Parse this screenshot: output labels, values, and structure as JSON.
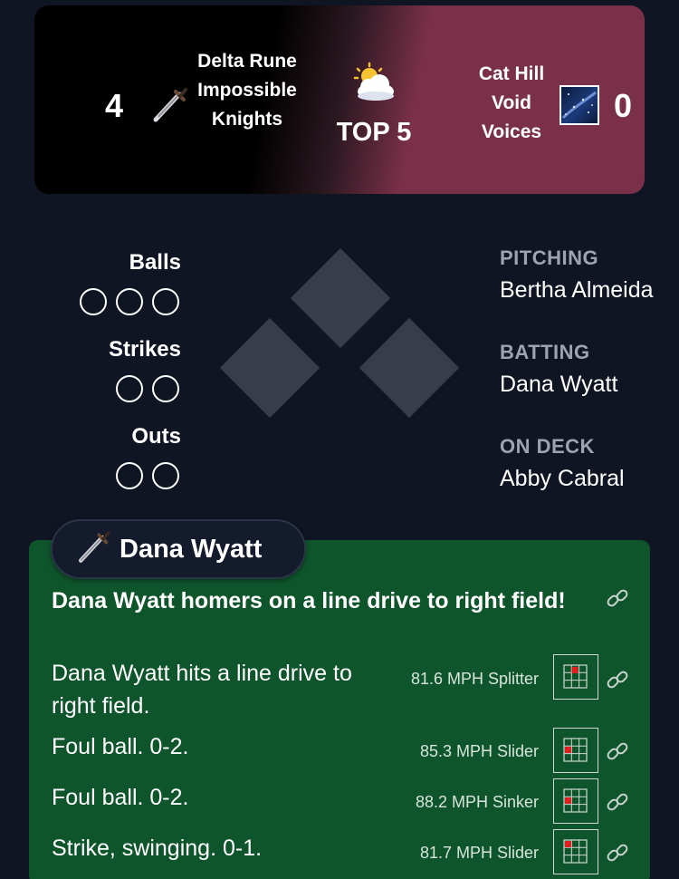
{
  "scoreboard": {
    "away": {
      "score": "4",
      "name": "Delta Rune Impossible Knights",
      "logo": "dagger-icon"
    },
    "home": {
      "score": "0",
      "name": "Cat Hill Void Voices",
      "logo": "night-sky-icon"
    },
    "weather_icon": "sun-behind-cloud-icon",
    "inning": "TOP 5",
    "colors": {
      "away_bg": "#000000",
      "home_bg": "#7b3049"
    }
  },
  "count": {
    "balls_label": "Balls",
    "balls_total": 3,
    "strikes_label": "Strikes",
    "strikes_total": 2,
    "outs_label": "Outs",
    "outs_total": 2
  },
  "matchup": {
    "pitching_label": "PITCHING",
    "pitching_name": "Bertha Almeida",
    "batting_label": "BATTING",
    "batting_name": "Dana Wyatt",
    "on_deck_label": "ON DECK",
    "on_deck_name": "Abby Cabral"
  },
  "play": {
    "batter": "Dana Wyatt",
    "batter_icon": "dagger-icon",
    "headline": "Dana Wyatt homers on a line drive to right field!",
    "panel_color": "#0f552c",
    "events": [
      {
        "text": "Dana Wyatt hits a line drive to right field.",
        "pitch": "81.6 MPH Splitter"
      },
      {
        "text": "Foul ball. 0-2.",
        "pitch": "85.3 MPH Slider"
      },
      {
        "text": "Foul ball. 0-2.",
        "pitch": "88.2 MPH Sinker"
      },
      {
        "text": "Strike, swinging. 0-1.",
        "pitch": "81.7 MPH Slider"
      }
    ]
  }
}
